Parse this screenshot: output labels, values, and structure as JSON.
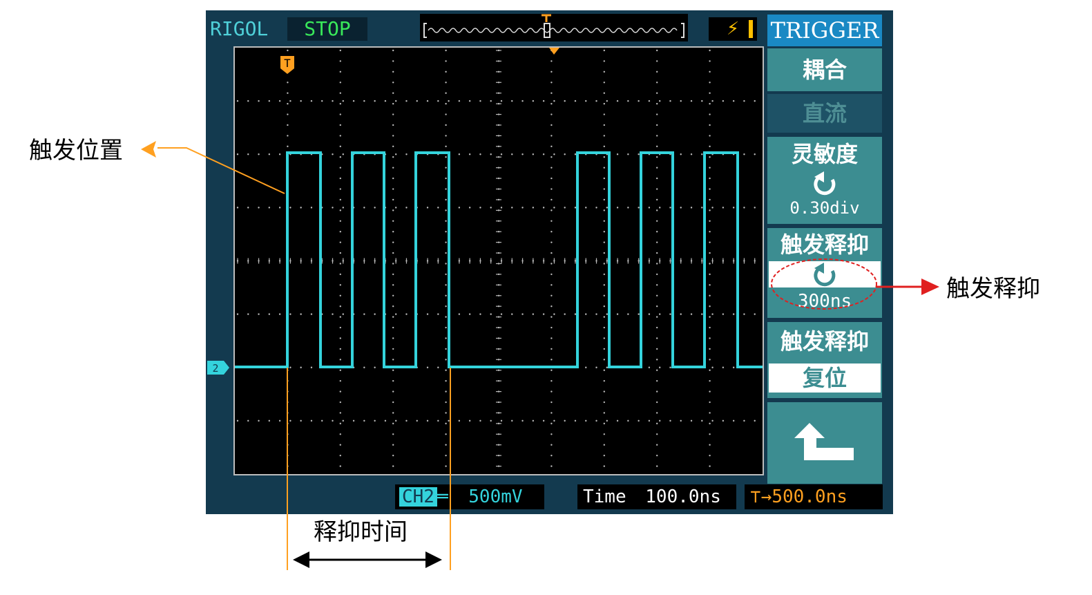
{
  "topbar": {
    "brand": "RIGOL",
    "run_status": "STOP",
    "trigger_marker": "T"
  },
  "menu": {
    "title": "TRIGGER",
    "coupling_label": "耦合",
    "coupling_value": "直流",
    "sensitivity_label": "灵敏度",
    "sensitivity_value": "0.30div",
    "holdoff_label": "触发释抑",
    "holdoff_value": "300ns",
    "holdoff_reset_label": "触发释抑",
    "holdoff_reset_value": "复位",
    "back_icon": "return-arrow-icon"
  },
  "status": {
    "channel": "CH2",
    "volts_div": "500mV",
    "time_label": "Time",
    "time_div": "100.0ns",
    "trigger_offset": "500.0ns",
    "channel_marker": "2"
  },
  "annotations": {
    "trigger_position": "触发位置",
    "holdoff": "触发释抑",
    "holdoff_time": "释抑时间"
  },
  "colors": {
    "trace": "#34d3dc",
    "trigger": "#ffa020",
    "menu_tile": "#3c8d91",
    "title": "#1a89c4",
    "highlight_circle": "#e02020"
  }
}
